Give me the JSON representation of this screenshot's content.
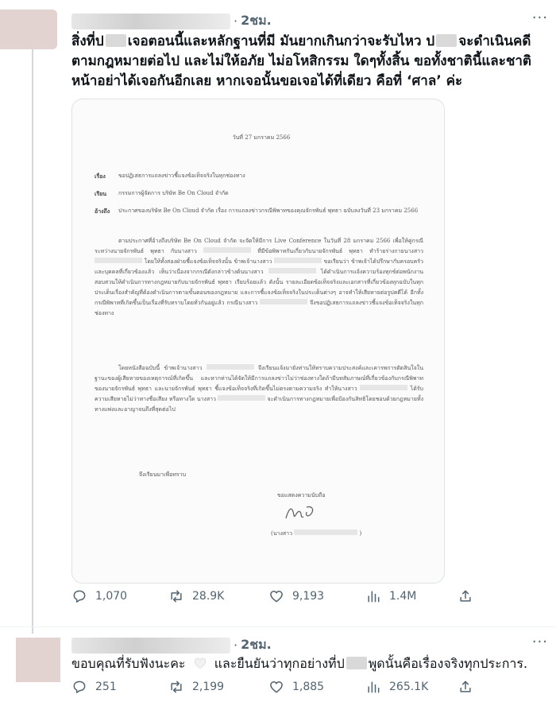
{
  "tweets": [
    {
      "time": "2ชม.",
      "more": "···",
      "text_parts": [
        "สิ่งที่ป",
        "เจอตอนนี้และหลักฐานที่มี มันยากเกินกว่าจะรับไหว ป",
        "จะดำเนินคดีตามกฎหมายต่อไป และไม่ให้อภัย ไม่อโหสิกรรม ใดๆทั้งสิ้น ขอทั้งชาตินี้และชาติหน้าอย่าได้เจอกันอีกเลย หากเจอนั้นขอเจอได้ที่เดียว คือที่ ‘ศาล’ ค่ะ"
      ],
      "document": {
        "date": "วันที่ 27 มกราคม 2566",
        "subject_label": "เรื่อง",
        "subject": "ขอปฏิเสธการแถลงข่าวชี้แจงข้อเท็จจริงในทุกช่องทาง",
        "to_label": "เรียน",
        "to": "กรรมการผู้จัดการ บริษัท Be On Cloud จำกัด",
        "ref_label": "อ้างถึง",
        "ref": "ประกาศของบริษัท Be On Cloud จำกัด เรื่อง การแถลงข่าวกรณีพิพาทของคุณจักรพันธ์ พุทธา ฉบับลงวันที่ 23 มกราคม 2566",
        "para1_a": "ตามประกาศที่อ้างถึงบริษัท Be On Cloud จำกัด จะจัดให้มีการ Live Conference ในวันที่ 28 มกราคม 2566 เพื่อให้คู่กรณีระหว่างนายจักรพันธ์ พุทธา กับนางสาว",
        "para1_b": "ที่มีข้อพิพาทกันเกี่ยวกับนายจักรพันธ์ พุทธา ทำร้ายร่างกายนางสาว",
        "para1_c": "โดยให้ทั้งสองฝ่ายชี้แจงข้อเท็จจริงนั้น ข้าพเจ้านางสาว",
        "para1_d": "ขอเรียนว่า ข้าพเจ้าได้ปรึกษากับครอบครัวและบุคคลที่เกี่ยวข้องแล้ว เห็นว่าเนื่องจากกรณีดังกล่าวข้างต้นนางสาว",
        "para1_e": "ได้ดำเนินการแจ้งความร้องทุกข์ต่อพนักงานสอบสวนให้ดำเนินการทางกฎหมายกับนายจักรพันธ์ พุทธา เรียบร้อยแล้ว ดังนั้น รายละเอียดข้อเท็จจริงและเอกสารที่เกี่ยวข้องทุกฉบับในทุกประเด็นเรื่องสำคัญที่ต้องดำเนินการตามขั้นตอนของกฎหมาย และการชี้แจงข้อเท็จจริงในประเด็นต่างๆ อาจทำให้เสียหายต่อรูปคดีได้ อีกทั้งกรณีพิพาทที่เกิดขึ้นเป็นเรื่องที่รับทราบโดยทั่วกันอยู่แล้ว กรณีนางสาว",
        "para1_f": "จึงขอปฏิเสธการแถลงข่าวชี้แจงข้อเท็จจริงในทุกช่องทาง",
        "para2_a": "โดยหนังสือฉบับนี้ ข้าพเจ้านางสาว",
        "para2_b": "จึงเรียนแจ้งมายังท่านให้ทราบความประสงค์และเคารพการตัดสินใจในฐานะของผู้เสียหายของเหตุการณ์ที่เกิดขึ้น และหากท่านได้จัดให้มีการแถลงข่าวไม่ว่าช่องทางใดถ้ามีบทสัมภาษณ์ที่เกี่ยวข้องกับกรณีพิพาทของนายจักรพันธ์ พุทธา และนายจักรพันธ์ พุทธา ชี้แจงข้อเท็จจริงที่เกิดขึ้นไม่ตรงตามความจริง ทำให้นางสาว",
        "para2_c": "ได้รับความเสียหายไม่ว่าทางชื่อเสียง หรือทางใด นางสาว",
        "para2_d": "จะดำเนินการทางกฎหมายเพื่อป้องกันสิทธิโดยชอบด้วยกฎหมายทั้งทางแพ่งและอาญาจนถึงที่สุดต่อไป",
        "closing": "จึงเรียนมาเพื่อทราบ",
        "sign_header": "ขอแสดงความนับถือ",
        "sign_name_prefix": "(นางสาว",
        "sign_name_suffix": ")"
      },
      "stats": {
        "replies": "1,070",
        "retweets": "28.9K",
        "likes": "9,193",
        "views": "1.4M"
      }
    },
    {
      "time": "2ชม.",
      "more": "···",
      "text_parts": [
        "ขอบคุณที่รับฟังนะคะ",
        "และยืนยันว่าทุกอย่างที่ป",
        "พูดนั้นคือเรื่องจริงทุกประการ."
      ],
      "stats": {
        "replies": "251",
        "retweets": "2,199",
        "likes": "1,885",
        "views": "265.1K"
      }
    }
  ],
  "icons": [
    "reply-icon",
    "retweet-icon",
    "like-icon",
    "views-icon",
    "share-icon",
    "white-heart-icon"
  ],
  "colors": {
    "text": "#0f1419",
    "secondary": "#536471",
    "border": "#eff3f4"
  }
}
